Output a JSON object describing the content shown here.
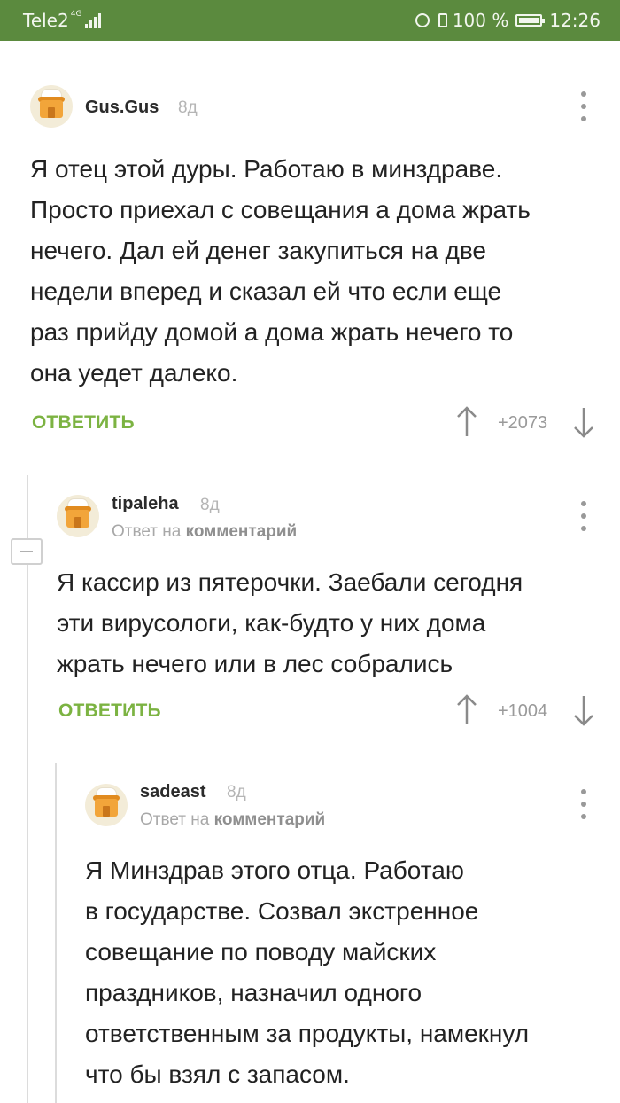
{
  "status_bar": {
    "carrier": "Tele2",
    "network": "4G",
    "battery": "100 %",
    "time": "12:26"
  },
  "comments": [
    {
      "username": "Gus.Gus",
      "time_ago": "8д",
      "text_lines": [
        "Я отец этой дуры. Работаю в минздраве.",
        "Просто приехал с совещания а дома жрать",
        "нечего. Дал ей денег закупиться на две",
        "недели вперед и сказал ей что если еще",
        "раз прийду домой а дома жрать нечего то",
        "она уедет далеко."
      ],
      "reply_label": "ОТВЕТИТЬ",
      "rating": "+2073"
    },
    {
      "username": "tipaleha",
      "time_ago": "8д",
      "reply_prefix": "Ответ на",
      "reply_target": "комментарий",
      "text_lines": [
        "Я кассир из пятерочки. Заебали сегодня",
        "эти вирусологи, как-будто у них дома",
        "жрать нечего или в лес собрались"
      ],
      "reply_label": "ОТВЕТИТЬ",
      "rating": "+1004"
    },
    {
      "username": "sadeast",
      "time_ago": "8д",
      "reply_prefix": "Ответ на",
      "reply_target": "комментарий",
      "text_lines": [
        "Я Минздрав этого отца. Работаю",
        "в государстве. Созвал экстренное",
        "совещание по поводу майских",
        "праздников, назначил одного",
        "ответственным за продукты, намекнул",
        "что бы взял с запасом."
      ]
    }
  ],
  "colors": {
    "status_bar": "#5b8a3e",
    "accent": "#7cb342",
    "muted": "#b5b5b5"
  }
}
